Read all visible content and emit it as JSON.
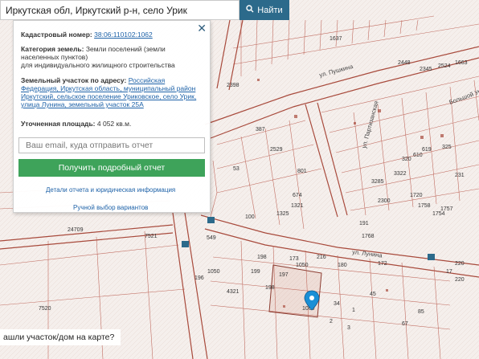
{
  "search": {
    "value": "Иркутская обл, Иркутский р-н, село Урик",
    "button_label": "Найти",
    "button_icon": "search-icon"
  },
  "panel": {
    "cadastral_label": "Кадастровый номер:",
    "cadastral_value": "38:06:110102:1062",
    "category_label": "Категория земель:",
    "category_value_line1": "Земли поселений (земли",
    "category_value_line2": "населенных пунктов)",
    "category_value_line3": "для индивидуального жилищного строительства",
    "address_label": "Земельный участок по адресу:",
    "address_line1": "Российская",
    "address_line2": "Федерация, Иркутская область, муниципальный район",
    "address_line3": "Иркутский, сельское поселение Уриковское, село Урик,",
    "address_line4": "улица Лунина, земельный участок 25А",
    "area_label": "Уточненная площадь:",
    "area_value": "4 052 кв.м.",
    "email_placeholder": "Ваш email, куда отправить отчет",
    "report_button": "Получить подробный отчет",
    "details_link": "Детали отчета и юридическая информация",
    "manual_link": "Ручной выбор вариантов",
    "close_glyph": "✕",
    "accent_color": "#3ea35a"
  },
  "bottom": {
    "question": "ашли участок/дом на карте?"
  },
  "map": {
    "parcel_labels": [
      "2529",
      "801",
      "387",
      "2398",
      "3285",
      "3322",
      "2300",
      "1768",
      "1754",
      "191",
      "7521",
      "7520",
      "4321",
      "1050",
      "1050",
      "197",
      "198",
      "199",
      "172",
      "1060",
      "2448",
      "24709",
      "2345",
      "2524",
      "1663",
      "1637",
      "180",
      "173",
      "216",
      "17",
      "220",
      "220",
      "100",
      "85",
      "45",
      "53",
      "549",
      "196",
      "198",
      "67",
      "34",
      "1",
      "2",
      "3",
      "1325",
      "1321",
      "674",
      "320",
      "610",
      "619",
      "325",
      "231",
      "1720",
      "1758",
      "1757"
    ],
    "street_labels": [
      "ул. Лунина",
      "ул. Пушкина",
      "ул. Партизанская",
      "Большой Урик"
    ],
    "marker_icon": "map-pin-icon"
  }
}
